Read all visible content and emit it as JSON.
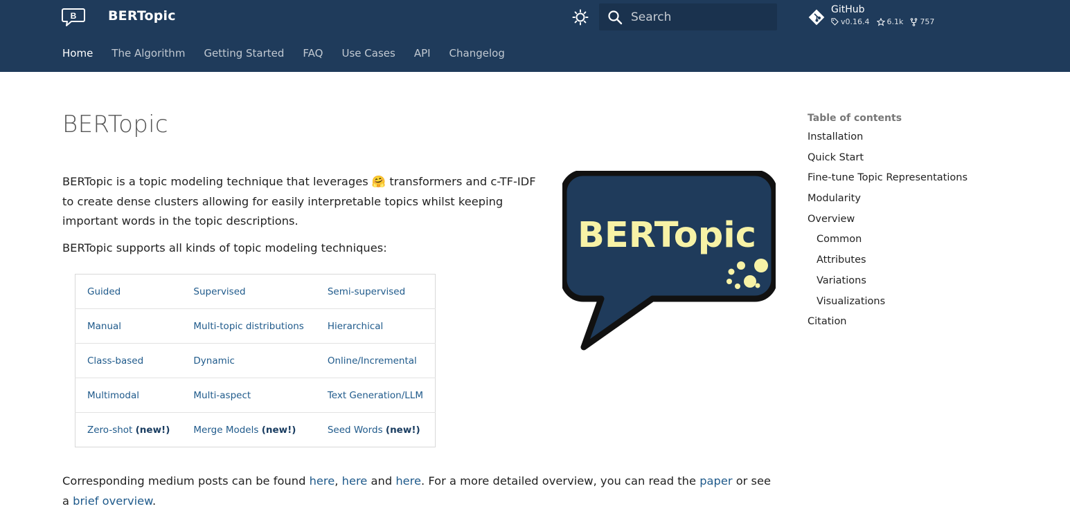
{
  "header": {
    "site_title": "BERTopic",
    "search_placeholder": "Search",
    "repo": {
      "name": "GitHub",
      "version": "v0.16.4",
      "stars": "6.1k",
      "forks": "757"
    }
  },
  "tabs": [
    {
      "label": "Home"
    },
    {
      "label": "The Algorithm"
    },
    {
      "label": "Getting Started"
    },
    {
      "label": "FAQ"
    },
    {
      "label": "Use Cases"
    },
    {
      "label": "API"
    },
    {
      "label": "Changelog"
    }
  ],
  "main": {
    "title": "BERTopic",
    "intro_part1": "BERTopic is a topic modeling technique that leverages ",
    "intro_emoji": "🤗",
    "intro_part2": " transformers and c-TF-IDF to create dense clusters allowing for easily interpretable topics whilst keeping important words in the topic descriptions.",
    "supports": "BERTopic supports all kinds of topic modeling techniques:",
    "techniques": [
      [
        "Guided",
        "Supervised",
        "Semi-supervised"
      ],
      [
        "Manual",
        "Multi-topic distributions",
        "Hierarchical"
      ],
      [
        "Class-based",
        "Dynamic",
        "Online/Incremental"
      ],
      [
        "Multimodal",
        "Multi-aspect",
        "Text Generation/LLM"
      ],
      [
        "Zero-shot",
        "Merge Models",
        "Seed Words"
      ]
    ],
    "new_tag": "(new!)",
    "medium": {
      "t1": "Corresponding medium posts can be found ",
      "l1": "here",
      "t2": ", ",
      "l2": "here",
      "t3": " and ",
      "l3": "here",
      "t4": ". For a more detailed overview, you can read the ",
      "l4": "paper",
      "t5": " or see a ",
      "l5": "brief overview",
      "t6": "."
    },
    "hero_logo_text": "BERTopic"
  },
  "toc": {
    "title": "Table of contents",
    "items": [
      {
        "label": "Installation",
        "level": 1
      },
      {
        "label": "Quick Start",
        "level": 1
      },
      {
        "label": "Fine-tune Topic Representations",
        "level": 1
      },
      {
        "label": "Modularity",
        "level": 1
      },
      {
        "label": "Overview",
        "level": 1
      },
      {
        "label": "Common",
        "level": 2
      },
      {
        "label": "Attributes",
        "level": 2
      },
      {
        "label": "Variations",
        "level": 2
      },
      {
        "label": "Visualizations",
        "level": 2
      },
      {
        "label": "Citation",
        "level": 1
      }
    ]
  },
  "colors": {
    "header_bg": "#1f3b5b",
    "link": "#1f5a8b",
    "logo_yellow": "#f7f2a6"
  },
  "icons": {
    "logo": "speech-bubble-b-icon",
    "theme": "brightness-icon",
    "search": "search-icon",
    "repo": "git-icon",
    "tag": "tag-icon",
    "star": "star-icon",
    "fork": "fork-icon"
  }
}
